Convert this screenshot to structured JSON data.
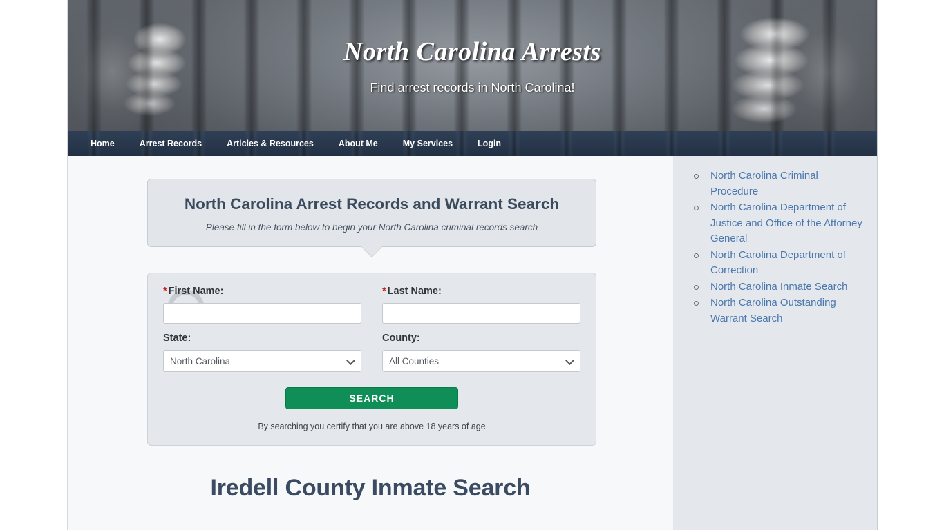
{
  "site": {
    "title": "North Carolina Arrests",
    "tagline": "Find arrest records in North Carolina!"
  },
  "nav": {
    "items": [
      {
        "label": "Home",
        "name": "home"
      },
      {
        "label": "Arrest Records",
        "name": "arrest-records"
      },
      {
        "label": "Articles & Resources",
        "name": "articles-resources"
      },
      {
        "label": "About Me",
        "name": "about-me"
      },
      {
        "label": "My Services",
        "name": "my-services"
      },
      {
        "label": "Login",
        "name": "login"
      }
    ]
  },
  "form_header": {
    "title": "North Carolina Arrest Records and Warrant Search",
    "subtitle": "Please fill in the form below to begin your North Carolina criminal records search"
  },
  "form": {
    "first_name_required_marker": "*",
    "first_name_label": "First Name:",
    "first_name_value": "",
    "first_name_placeholder": "",
    "last_name_required_marker": "*",
    "last_name_label": "Last Name:",
    "last_name_value": "",
    "last_name_placeholder": "",
    "state_label": "State:",
    "state_value": "North Carolina",
    "state_options": [
      "North Carolina"
    ],
    "county_label": "County:",
    "county_value": "All Counties",
    "county_options": [
      "All Counties"
    ],
    "search_button_label": "SEARCH",
    "certify_text": "By searching you certify that you are above 18 years of age"
  },
  "main": {
    "page_heading": "Iredell County Inmate Search"
  },
  "sidebar": {
    "links": [
      "North Carolina Criminal Procedure",
      "North Carolina Department of Justice and Office of the Attorney General",
      "North Carolina Department of Correction",
      "North Carolina Inmate Search",
      "North Carolina Outstanding Warrant Search"
    ]
  },
  "colors": {
    "nav_bg": "#29384c",
    "search_green": "#0f8f57",
    "link_blue": "#4a77ad",
    "heading_slate": "#3a4b62",
    "required_red": "#cc2222",
    "sidebar_bg": "#e4e8ed",
    "panel_bg": "#e4e8ec"
  }
}
